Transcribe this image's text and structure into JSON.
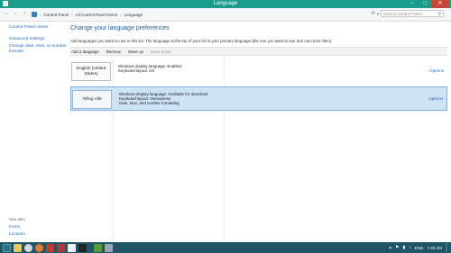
{
  "window": {
    "title": "Language",
    "minimize": "–",
    "maximize": "□",
    "close": "✕"
  },
  "address": {
    "back": "←",
    "forward": "→",
    "up": "↑",
    "breadcrumbs": [
      "Control Panel",
      "All Control Panel Items",
      "Language"
    ],
    "separator": "›",
    "dropdown": "▾",
    "refresh": "⟳",
    "search_placeholder": "Search Control Panel"
  },
  "sidebar": {
    "items": [
      "Control Panel Home",
      "Advanced settings",
      "Change date, time, or number formats"
    ],
    "see_also_label": "See also",
    "see_also_items": [
      "Fonts",
      "Location"
    ]
  },
  "main": {
    "heading": "Change your language preferences",
    "description": "Add languages you want to use to this list. The language at the top of your list is your primary language (the one you want to see and use most often).",
    "toolbar": {
      "add_language": "Add a language",
      "remove": "Remove",
      "move_up": "Move up",
      "move_down": "Move down"
    },
    "languages": [
      {
        "name": "English (United States)",
        "lines": [
          "Windows display language: Enabled",
          "Keyboard layout: US"
        ],
        "options": "Options"
      },
      {
        "name": "Tiếng Việt",
        "lines": [
          "Windows display language: Available for download",
          "Keyboard layout: Vietnamese",
          "Date, time, and number formatting"
        ],
        "options": "Options"
      }
    ]
  },
  "taskbar": {
    "app_icons": [
      "start-button",
      "file-explorer-icon",
      "chrome-icon",
      "firefox-icon",
      "email-icon",
      "pdf-icon",
      "notepad-icon",
      "cmd-icon",
      "control-panel-icon",
      "calculator-icon"
    ],
    "tray": {
      "language": "ENG",
      "time": "7:40 AM"
    }
  },
  "colors": {
    "titlebar": "#1a9c8c",
    "taskbar": "#1f5566",
    "link": "#2a6cb0",
    "selected_row": "#cde4f7"
  }
}
